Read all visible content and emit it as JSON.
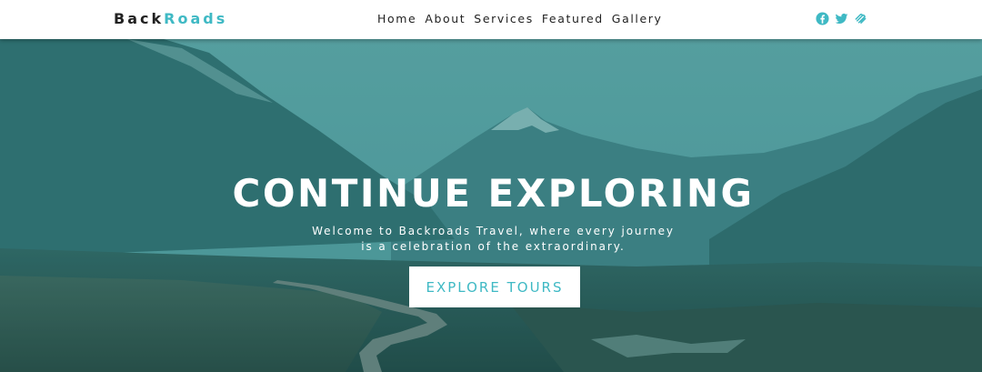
{
  "brand": {
    "part1": "Back",
    "part2": "Roads"
  },
  "nav": {
    "links": [
      "Home",
      "About",
      "Services",
      "Featured",
      "Gallery"
    ]
  },
  "social": {
    "icons": [
      "facebook-icon",
      "twitter-icon",
      "squarespace-icon"
    ],
    "color": "#3fb9c4"
  },
  "hero": {
    "title": "CONTINUE EXPLORING",
    "subtitle_line1": "Welcome to Backroads Travel, where every journey",
    "subtitle_line2": "is a celebration of the extraordinary.",
    "button_label": "EXPLORE TOURS",
    "overlay_color": "#2a8c8c"
  },
  "colors": {
    "accent": "#3fb9c4",
    "text_dark": "#222222",
    "nav_bg": "#ffffff"
  }
}
